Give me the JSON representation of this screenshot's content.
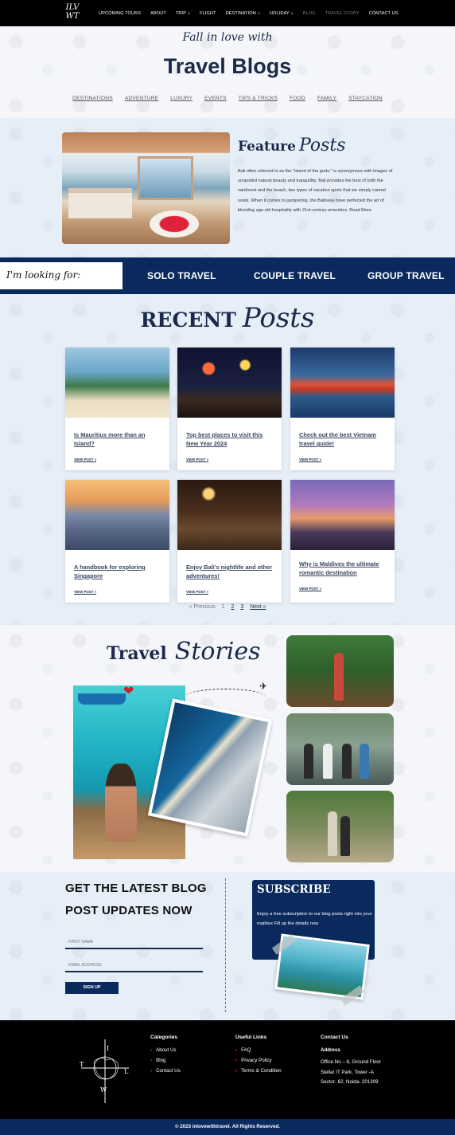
{
  "nav": {
    "logo_text": "ILV WT",
    "items": [
      {
        "label": "UPCOMING TOURS",
        "dropdown": false,
        "active": true
      },
      {
        "label": "ABOUT",
        "dropdown": false,
        "active": true
      },
      {
        "label": "TRIP",
        "dropdown": true,
        "active": true
      },
      {
        "label": "FLIGHT",
        "dropdown": false,
        "active": true
      },
      {
        "label": "DESTINATION",
        "dropdown": true,
        "active": true
      },
      {
        "label": "HOLIDAY",
        "dropdown": true,
        "active": true
      },
      {
        "label": "BLOG",
        "dropdown": false,
        "active": false
      },
      {
        "label": "TRAVEL STORY",
        "dropdown": false,
        "active": false
      },
      {
        "label": "CONTACT US",
        "dropdown": false,
        "active": true
      }
    ],
    "dropdown_icon": "chevron-down-icon"
  },
  "hero": {
    "subtitle": "Fall in love with",
    "title": "Travel Blogs",
    "categories": [
      "DESTINATIONS",
      "ADVENTURE",
      "LUXURY",
      "EVENTS",
      "TIPS & TRICKS",
      "FOOD",
      "FAMILY",
      "STAYCATION"
    ]
  },
  "feature": {
    "title_main": "Feature",
    "title_script": "Posts",
    "text": "Bali often referred to as the \"island of the gods,\" is synonymous with images of unspoiled natural beauty and tranquillity. Bali provides the best of both the rainforest and the beach, two types of vacation spots that we simply cannot resist. When it comes to pampering, the Balinese have perfected the art of blending age-old hospitality with 21st-century amenities. Read More"
  },
  "looking": {
    "label": "I'm looking for:",
    "options": [
      "SOLO TRAVEL",
      "COUPLE TRAVEL",
      "GROUP TRAVEL"
    ]
  },
  "recent": {
    "title_main": "RECENT",
    "title_script": "Posts",
    "view_label": "VIEW POST »",
    "posts": [
      {
        "title": "Is Mauritius more than an Island?"
      },
      {
        "title": "Top best places to visit this New Year 2024"
      },
      {
        "title": "Check out the best Vietnam travel guide!"
      },
      {
        "title": "A handbook for exploring Singapore"
      },
      {
        "title": "Enjoy Bali's nightlife and other adventures!"
      },
      {
        "title": "Why is Maldives the ultimate romantic destination"
      }
    ],
    "pagination": {
      "prev": "« Previous",
      "pages": [
        "1",
        "2",
        "3"
      ],
      "current": "1",
      "next": "Next »"
    }
  },
  "stories": {
    "title_main": "Travel",
    "title_script": "Stories",
    "plane_icon": "airplane-icon",
    "heart_icon": "heart-icon"
  },
  "subscribe": {
    "headline_1": "GET THE LATEST BLOG",
    "headline_2": "POST UPDATES NOW",
    "first_name_placeholder": "FIRST NAME",
    "email_placeholder": "EMAIL ADDRESS",
    "button": "SIGN UP",
    "card_title": "SUBSCRIBE",
    "card_text": "Enjoy a free subscription to our blog posts right into your mailbox Fill up the details now"
  },
  "footer": {
    "categories": {
      "heading": "Categories",
      "links": [
        "About Us",
        "Blog",
        "Contact Us"
      ]
    },
    "useful": {
      "heading": "Useful Links",
      "links": [
        "FAQ",
        "Privacy Policy",
        "Terms & Condition"
      ]
    },
    "contact": {
      "heading": "Contact Us",
      "address_label": "Address",
      "address_lines": [
        "Office No – 8, Ground Floor",
        "Stellar IT Park, Tower -A",
        "Sector- 62, Noida- 201309"
      ]
    },
    "copyright": "© 2023 inlovewithtravel. All Rights Reserved.",
    "compass_letters": [
      "I",
      "T",
      "L",
      "W"
    ]
  },
  "colors": {
    "navy": "#0a2a5e",
    "ink": "#1b2a4a",
    "accent": "#e8402a",
    "black": "#000000"
  }
}
